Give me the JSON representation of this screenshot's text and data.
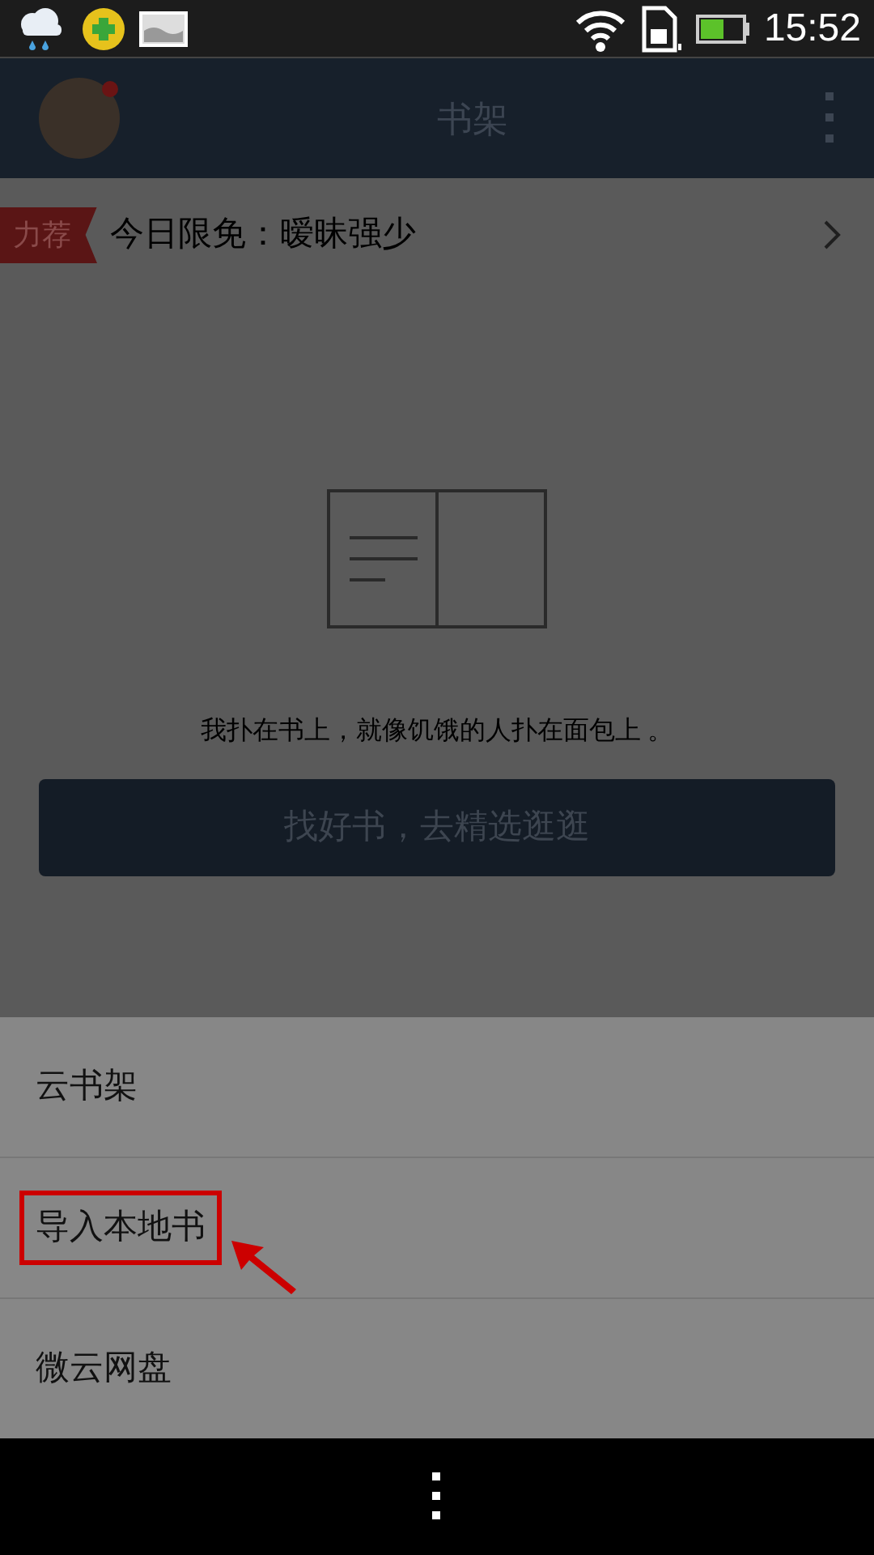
{
  "status_bar": {
    "time": "15:52"
  },
  "header": {
    "title": "书架",
    "avatar_badge": true
  },
  "promo": {
    "tag": "力荐",
    "text": "今日限免：暧昧强少"
  },
  "empty_state": {
    "message": "我扑在书上，就像饥饿的人扑在面包上 。",
    "button": "找好书，去精选逛逛"
  },
  "menu": [
    {
      "label": "云书架",
      "annotated": false
    },
    {
      "label": "导入本地书",
      "annotated": true
    },
    {
      "label": "微云网盘",
      "annotated": false
    }
  ]
}
